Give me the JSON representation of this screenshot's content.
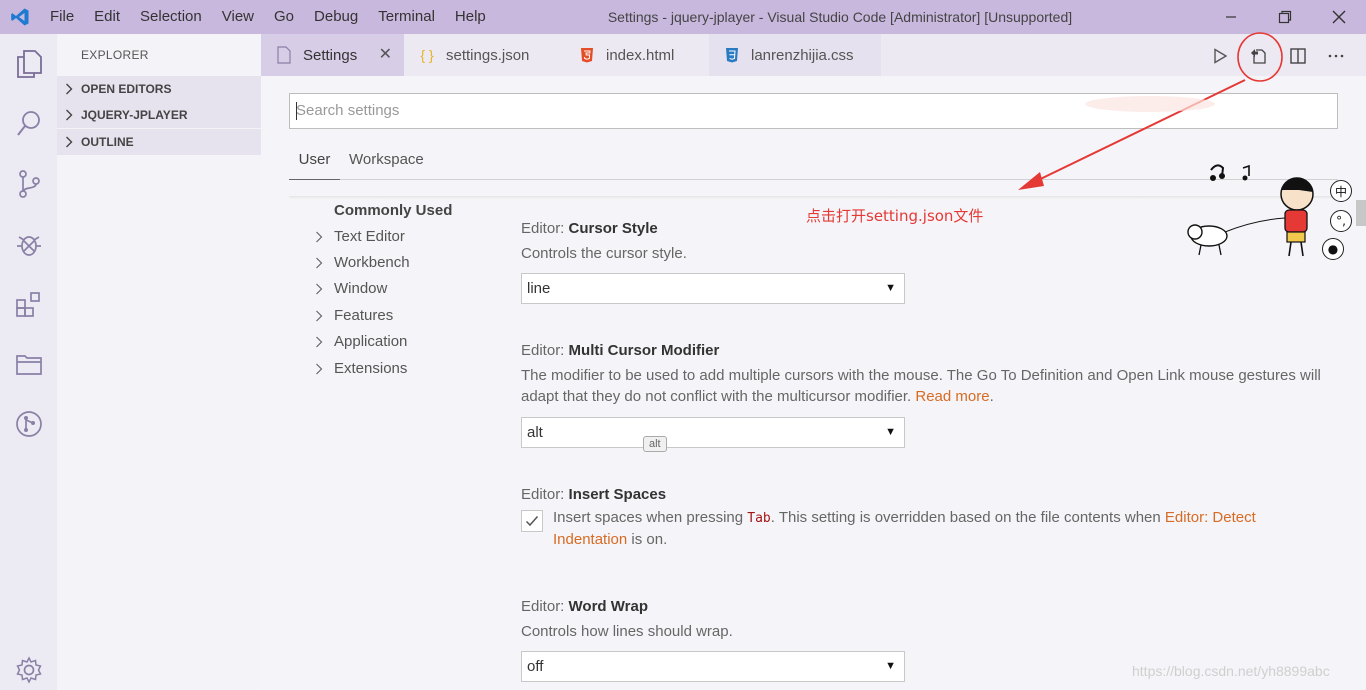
{
  "titlebar": {
    "menu": [
      "File",
      "Edit",
      "Selection",
      "View",
      "Go",
      "Debug",
      "Terminal",
      "Help"
    ],
    "title": "Settings - jquery-jplayer - Visual Studio Code [Administrator] [Unsupported]"
  },
  "sidebar": {
    "title": "EXPLORER",
    "sections": [
      "OPEN EDITORS",
      "JQUERY-JPLAYER",
      "OUTLINE"
    ]
  },
  "tabs": [
    {
      "label": "Settings",
      "icon": "settings-file-icon"
    },
    {
      "label": "settings.json",
      "icon": "json-braces-icon"
    },
    {
      "label": "index.html",
      "icon": "html5-icon"
    },
    {
      "label": "lanrenzhijia.css",
      "icon": "css3-icon"
    }
  ],
  "search": {
    "placeholder": "Search settings"
  },
  "scopes": {
    "user": "User",
    "workspace": "Workspace"
  },
  "toc": {
    "active": "Commonly Used",
    "items": [
      "Text Editor",
      "Workbench",
      "Window",
      "Features",
      "Application",
      "Extensions"
    ]
  },
  "settings": [
    {
      "category": "Editor: ",
      "name": "Cursor Style",
      "desc": "Controls the cursor style.",
      "value": "line"
    },
    {
      "category": "Editor: ",
      "name": "Multi Cursor Modifier",
      "desc": "The modifier to be used to add multiple cursors with the mouse. The Go To Definition and Open Link mouse gestures will adapt that they do not conflict with the multicursor modifier. ",
      "link": "Read more",
      "desc_end": ".",
      "value": "alt",
      "tooltip": "alt"
    },
    {
      "category": "Editor: ",
      "name": "Insert Spaces",
      "desc_a": "Insert spaces when pressing ",
      "code": "Tab",
      "desc_b": ". This setting is overridden based on the file contents when ",
      "link": "Editor: Detect Indentation",
      "desc_c": " is on.",
      "checked": true
    },
    {
      "category": "Editor: ",
      "name": "Word Wrap",
      "desc": "Controls how lines should wrap.",
      "value": "off"
    }
  ],
  "annotation": {
    "text": "点击打开setting.json文件",
    "color": "#e53935"
  },
  "ime": {
    "label": "中"
  },
  "watermark": "https://blog.csdn.net/yh8899abc",
  "colors": {
    "titlebar": "#c9b8de",
    "activity": "#ecebf3",
    "accent_link": "#d86b24",
    "active_tab": "#d7cde6"
  }
}
